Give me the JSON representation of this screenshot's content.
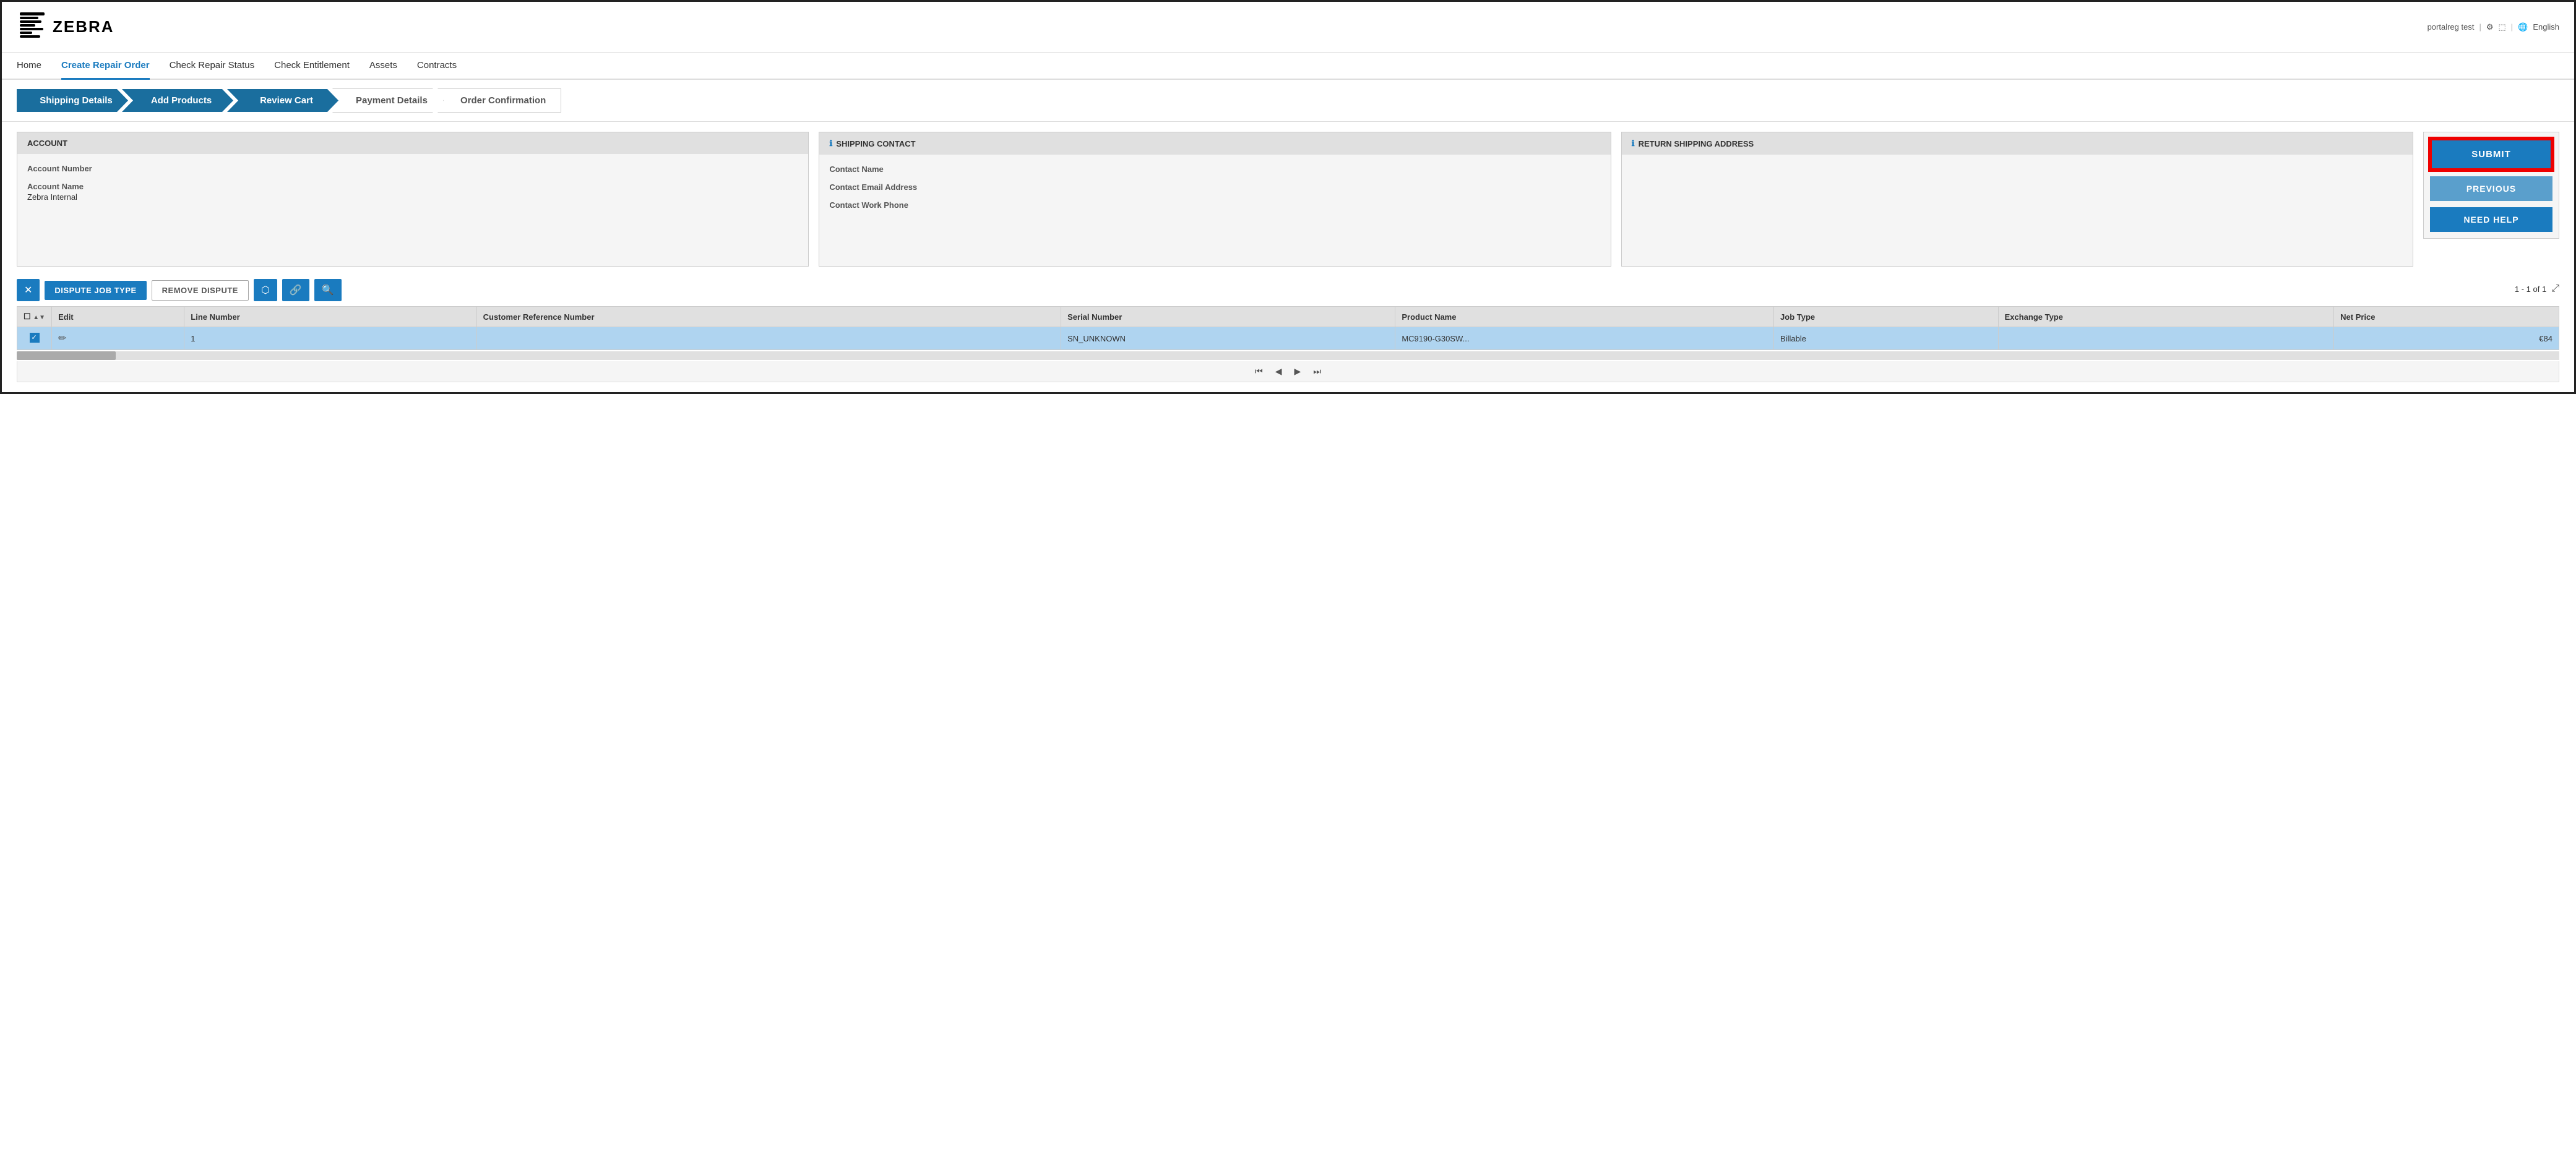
{
  "header": {
    "logo_text": "ZEBRA",
    "user_info": "portalreg test",
    "language": "English"
  },
  "nav": {
    "items": [
      {
        "id": "home",
        "label": "Home",
        "active": false
      },
      {
        "id": "create-repair-order",
        "label": "Create Repair Order",
        "active": true
      },
      {
        "id": "check-repair-status",
        "label": "Check Repair Status",
        "active": false
      },
      {
        "id": "check-entitlement",
        "label": "Check Entitlement",
        "active": false
      },
      {
        "id": "assets",
        "label": "Assets",
        "active": false
      },
      {
        "id": "contracts",
        "label": "Contracts",
        "active": false
      }
    ]
  },
  "stepper": {
    "steps": [
      {
        "id": "shipping-details",
        "label": "Shipping Details",
        "state": "filled"
      },
      {
        "id": "add-products",
        "label": "Add Products",
        "state": "filled"
      },
      {
        "id": "review-cart",
        "label": "Review Cart",
        "state": "filled"
      },
      {
        "id": "payment-details",
        "label": "Payment Details",
        "state": "outline"
      },
      {
        "id": "order-confirmation",
        "label": "Order Confirmation",
        "state": "outline"
      }
    ]
  },
  "account_panel": {
    "title": "ACCOUNT",
    "field1_label": "Account Number",
    "field2_label": "Account Name",
    "field2_value": "Zebra Internal"
  },
  "shipping_contact_panel": {
    "title": "SHIPPING CONTACT",
    "field1_label": "Contact Name",
    "field2_label": "Contact Email Address",
    "field3_label": "Contact Work Phone"
  },
  "return_address_panel": {
    "title": "RETURN SHIPPING ADDRESS"
  },
  "actions": {
    "submit_label": "SUBMIT",
    "previous_label": "PREVIOUS",
    "need_help_label": "NEED HELP"
  },
  "toolbar": {
    "dispute_job_type": "DISPUTE JOB TYPE",
    "remove_dispute": "REMOVE DISPUTE"
  },
  "pagination": {
    "text": "1 - 1 of 1"
  },
  "table": {
    "columns": [
      {
        "id": "checkbox",
        "label": ""
      },
      {
        "id": "edit",
        "label": "Edit"
      },
      {
        "id": "line-number",
        "label": "Line Number"
      },
      {
        "id": "customer-reference",
        "label": "Customer Reference Number"
      },
      {
        "id": "serial-number",
        "label": "Serial Number"
      },
      {
        "id": "product-name",
        "label": "Product Name"
      },
      {
        "id": "job-type",
        "label": "Job Type"
      },
      {
        "id": "exchange-type",
        "label": "Exchange Type"
      },
      {
        "id": "net-price",
        "label": "Net Price"
      }
    ],
    "rows": [
      {
        "checkbox": true,
        "edit": true,
        "line_number": "1",
        "customer_reference": "",
        "serial_number": "SN_UNKNOWN",
        "product_name": "MC9190-G30SW...",
        "job_type": "Billable",
        "exchange_type": "",
        "net_price": "€84"
      }
    ]
  }
}
